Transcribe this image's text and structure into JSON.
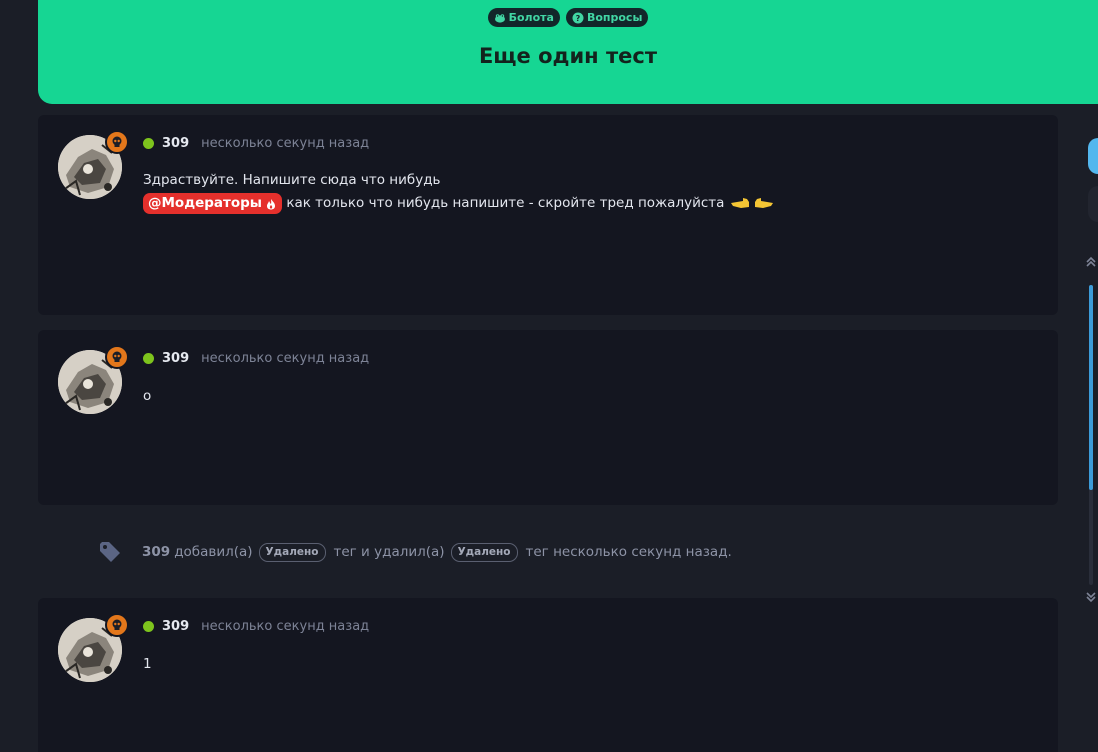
{
  "header": {
    "categories": [
      {
        "label": "Болота",
        "icon": "frog-icon"
      },
      {
        "label": "Вопросы",
        "icon": "question-circle-icon"
      }
    ],
    "title": "Еще один тест"
  },
  "posts": [
    {
      "username": "309",
      "time": "несколько секунд назад",
      "lines": [
        "Здраствуйте. Напишите сюда что нибудь"
      ],
      "mention": "@Модераторы",
      "after_mention": "как только что нибудь напишите - скройте тред пожалуйста"
    },
    {
      "username": "309",
      "time": "несколько секунд назад",
      "lines": [
        "о"
      ]
    },
    {
      "username": "309",
      "time": "несколько секунд назад",
      "lines": [
        "1"
      ]
    }
  ],
  "event": {
    "user": "309",
    "added": "добавил(а)",
    "tag1": "Удалено",
    "middle": "тег и удалил(а)",
    "tag2": "Удалено",
    "end": "тег несколько секунд назад."
  },
  "colors": {
    "header_bg": "#16d693",
    "post_bg": "#141620",
    "mention_bg": "#e5302c",
    "online": "#7ec41d",
    "badge": "#e3771b",
    "scroll_accent": "#3c9bd8"
  }
}
